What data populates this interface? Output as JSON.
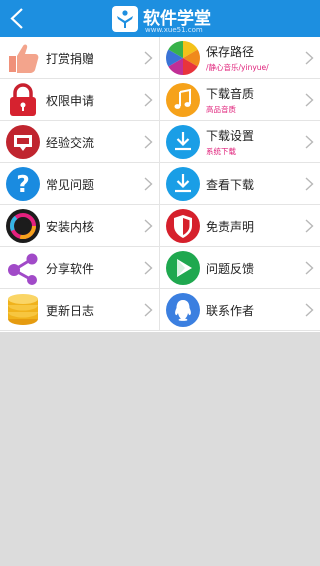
{
  "header": {
    "back_icon": "back-arrow-icon",
    "logo_text": "软件学堂",
    "logo_url": "www.xue51.com",
    "bg_color": "#1d8fe0"
  },
  "menu": {
    "left": [
      {
        "label": "打赏捐赠",
        "icon": "thumbs-up-icon"
      },
      {
        "label": "权限申请",
        "icon": "lock-icon"
      },
      {
        "label": "经验交流",
        "icon": "chat-bubble-icon"
      },
      {
        "label": "常见问题",
        "icon": "question-icon"
      },
      {
        "label": "安装内核",
        "icon": "ring-icon"
      },
      {
        "label": "分享软件",
        "icon": "share-icon"
      },
      {
        "label": "更新日志",
        "icon": "database-icon"
      }
    ],
    "right": [
      {
        "label": "保存路径",
        "sub": "/静心音乐/yinyue/",
        "icon": "color-wheel-icon"
      },
      {
        "label": "下载音质",
        "sub": "高品音质",
        "icon": "music-note-icon"
      },
      {
        "label": "下载设置",
        "sub": "系统下载",
        "icon": "download-icon"
      },
      {
        "label": "查看下载",
        "icon": "download-icon"
      },
      {
        "label": "免责声明",
        "icon": "shield-icon"
      },
      {
        "label": "问题反馈",
        "icon": "play-icon"
      },
      {
        "label": "联系作者",
        "icon": "qq-icon"
      }
    ]
  }
}
